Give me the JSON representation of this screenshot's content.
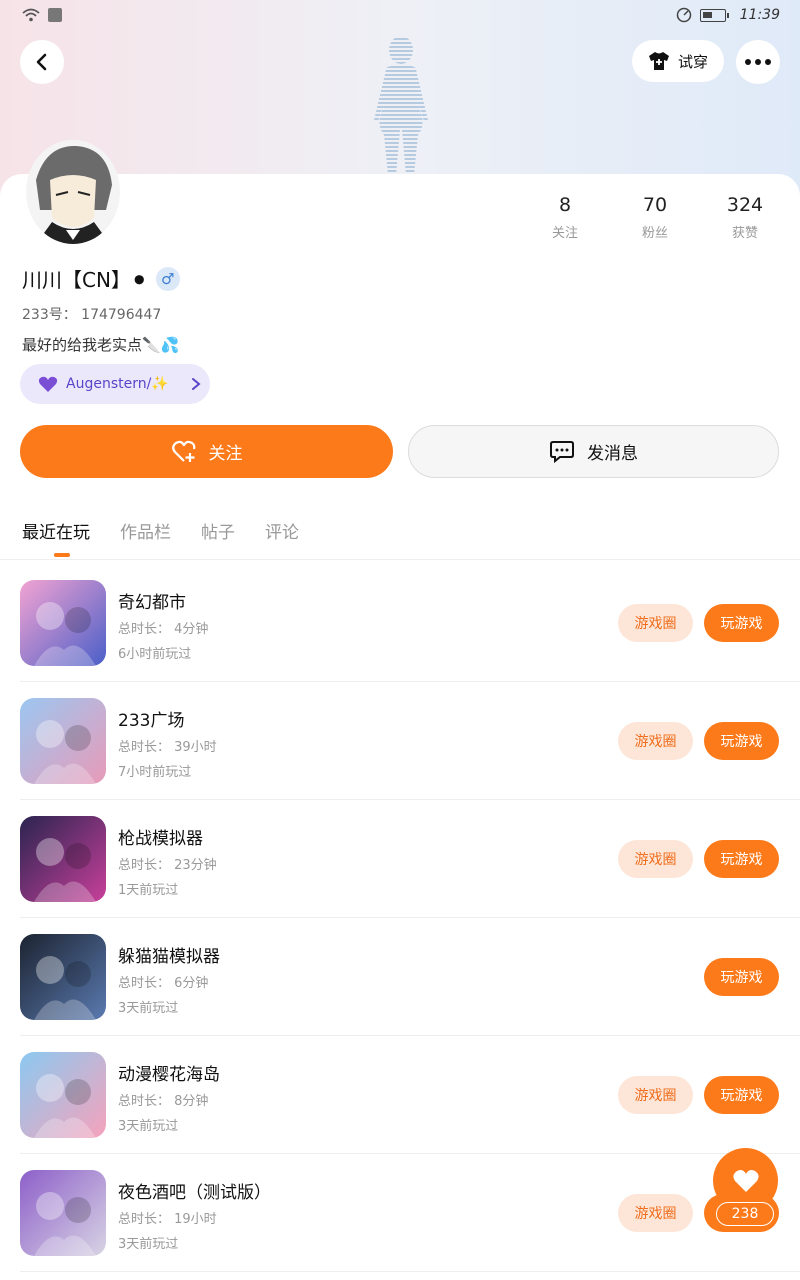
{
  "status_bar": {
    "time": "11:39"
  },
  "header": {
    "try_on_label": "试穿"
  },
  "profile": {
    "name": "川川【CN】⚫",
    "gender_symbol": "♂",
    "user_id": "233号： 174796447",
    "bio": "最好的给我老实点🔪💦",
    "group_chip": "Augenstern/✨"
  },
  "stats": [
    {
      "value": "8",
      "label": "关注"
    },
    {
      "value": "70",
      "label": "粉丝"
    },
    {
      "value": "324",
      "label": "获赞"
    }
  ],
  "actions": {
    "follow_label": "关注",
    "message_label": "发消息"
  },
  "tabs": [
    "最近在玩",
    "作品栏",
    "帖子",
    "评论"
  ],
  "game_circle_label": "游戏圈",
  "play_label": "玩游戏",
  "games": [
    {
      "title": "奇幻都市",
      "total": "总时长： 4分钟",
      "last": "6小时前玩过",
      "has_circle": true,
      "colors": [
        "#f3a3d2",
        "#4a5fc8"
      ]
    },
    {
      "title": "233广场",
      "total": "总时长： 39小时",
      "last": "7小时前玩过",
      "has_circle": true,
      "colors": [
        "#9cc7f1",
        "#e89ab8"
      ]
    },
    {
      "title": "枪战模拟器",
      "total": "总时长： 23分钟",
      "last": "1天前玩过",
      "has_circle": true,
      "colors": [
        "#2a2450",
        "#c8409a"
      ]
    },
    {
      "title": "躲猫猫模拟器",
      "total": "总时长： 6分钟",
      "last": "3天前玩过",
      "has_circle": false,
      "colors": [
        "#1c2330",
        "#5a7ab0"
      ]
    },
    {
      "title": "动漫樱花海岛",
      "total": "总时长： 8分钟",
      "last": "3天前玩过",
      "has_circle": true,
      "colors": [
        "#8cc9f0",
        "#f6a2bb"
      ]
    },
    {
      "title": "夜色酒吧（测试版）",
      "total": "总时长： 19小时",
      "last": "3天前玩过",
      "has_circle": true,
      "colors": [
        "#8d5fc9",
        "#d8d4e4"
      ]
    }
  ],
  "like_count": "238"
}
